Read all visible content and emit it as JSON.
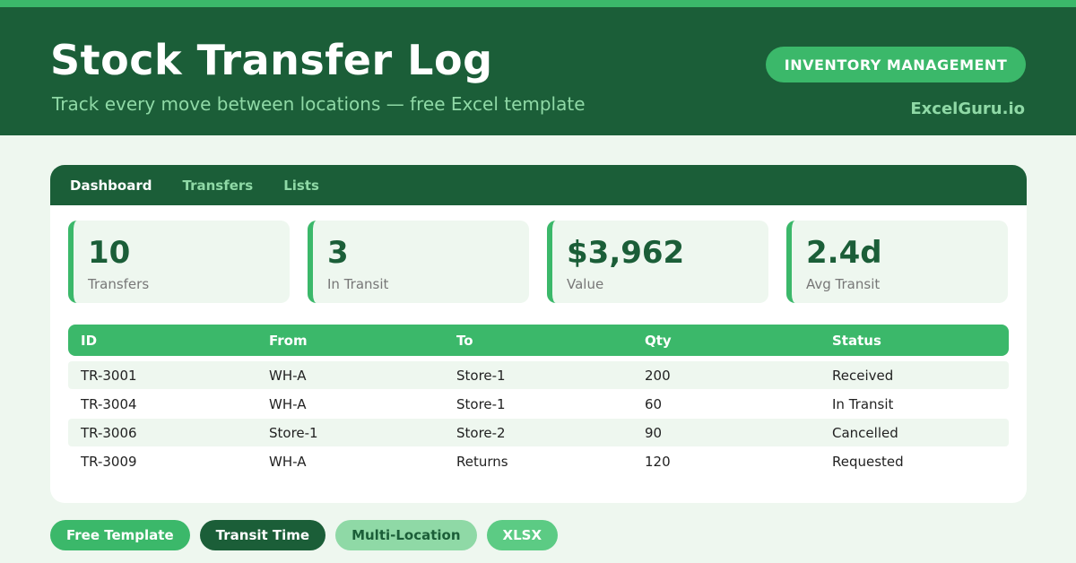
{
  "header": {
    "title": "Stock Transfer Log",
    "subtitle": "Track every move between locations — free Excel template",
    "category": "INVENTORY MANAGEMENT",
    "brand": "ExcelGuru.io"
  },
  "tabs": [
    {
      "label": "Dashboard",
      "active": true
    },
    {
      "label": "Transfers",
      "active": false
    },
    {
      "label": "Lists",
      "active": false
    }
  ],
  "kpis": [
    {
      "value": "10",
      "label": "Transfers"
    },
    {
      "value": "3",
      "label": "In Transit"
    },
    {
      "value": "$3,962",
      "label": "Value"
    },
    {
      "value": "2.4d",
      "label": "Avg Transit"
    }
  ],
  "table": {
    "columns": [
      "ID",
      "From",
      "To",
      "Qty",
      "Status"
    ],
    "rows": [
      [
        "TR-3001",
        "WH-A",
        "Store-1",
        "200",
        "Received"
      ],
      [
        "TR-3004",
        "WH-A",
        "Store-1",
        "60",
        "In Transit"
      ],
      [
        "TR-3006",
        "Store-1",
        "Store-2",
        "90",
        "Cancelled"
      ],
      [
        "TR-3009",
        "WH-A",
        "Returns",
        "120",
        "Requested"
      ]
    ]
  },
  "tags": [
    "Free Template",
    "Transit Time",
    "Multi-Location",
    "XLSX"
  ],
  "colors": {
    "primary_dark": "#1b5e38",
    "accent": "#3bb86a",
    "accent_light": "#8fd9a6",
    "background": "#eef7ef"
  }
}
